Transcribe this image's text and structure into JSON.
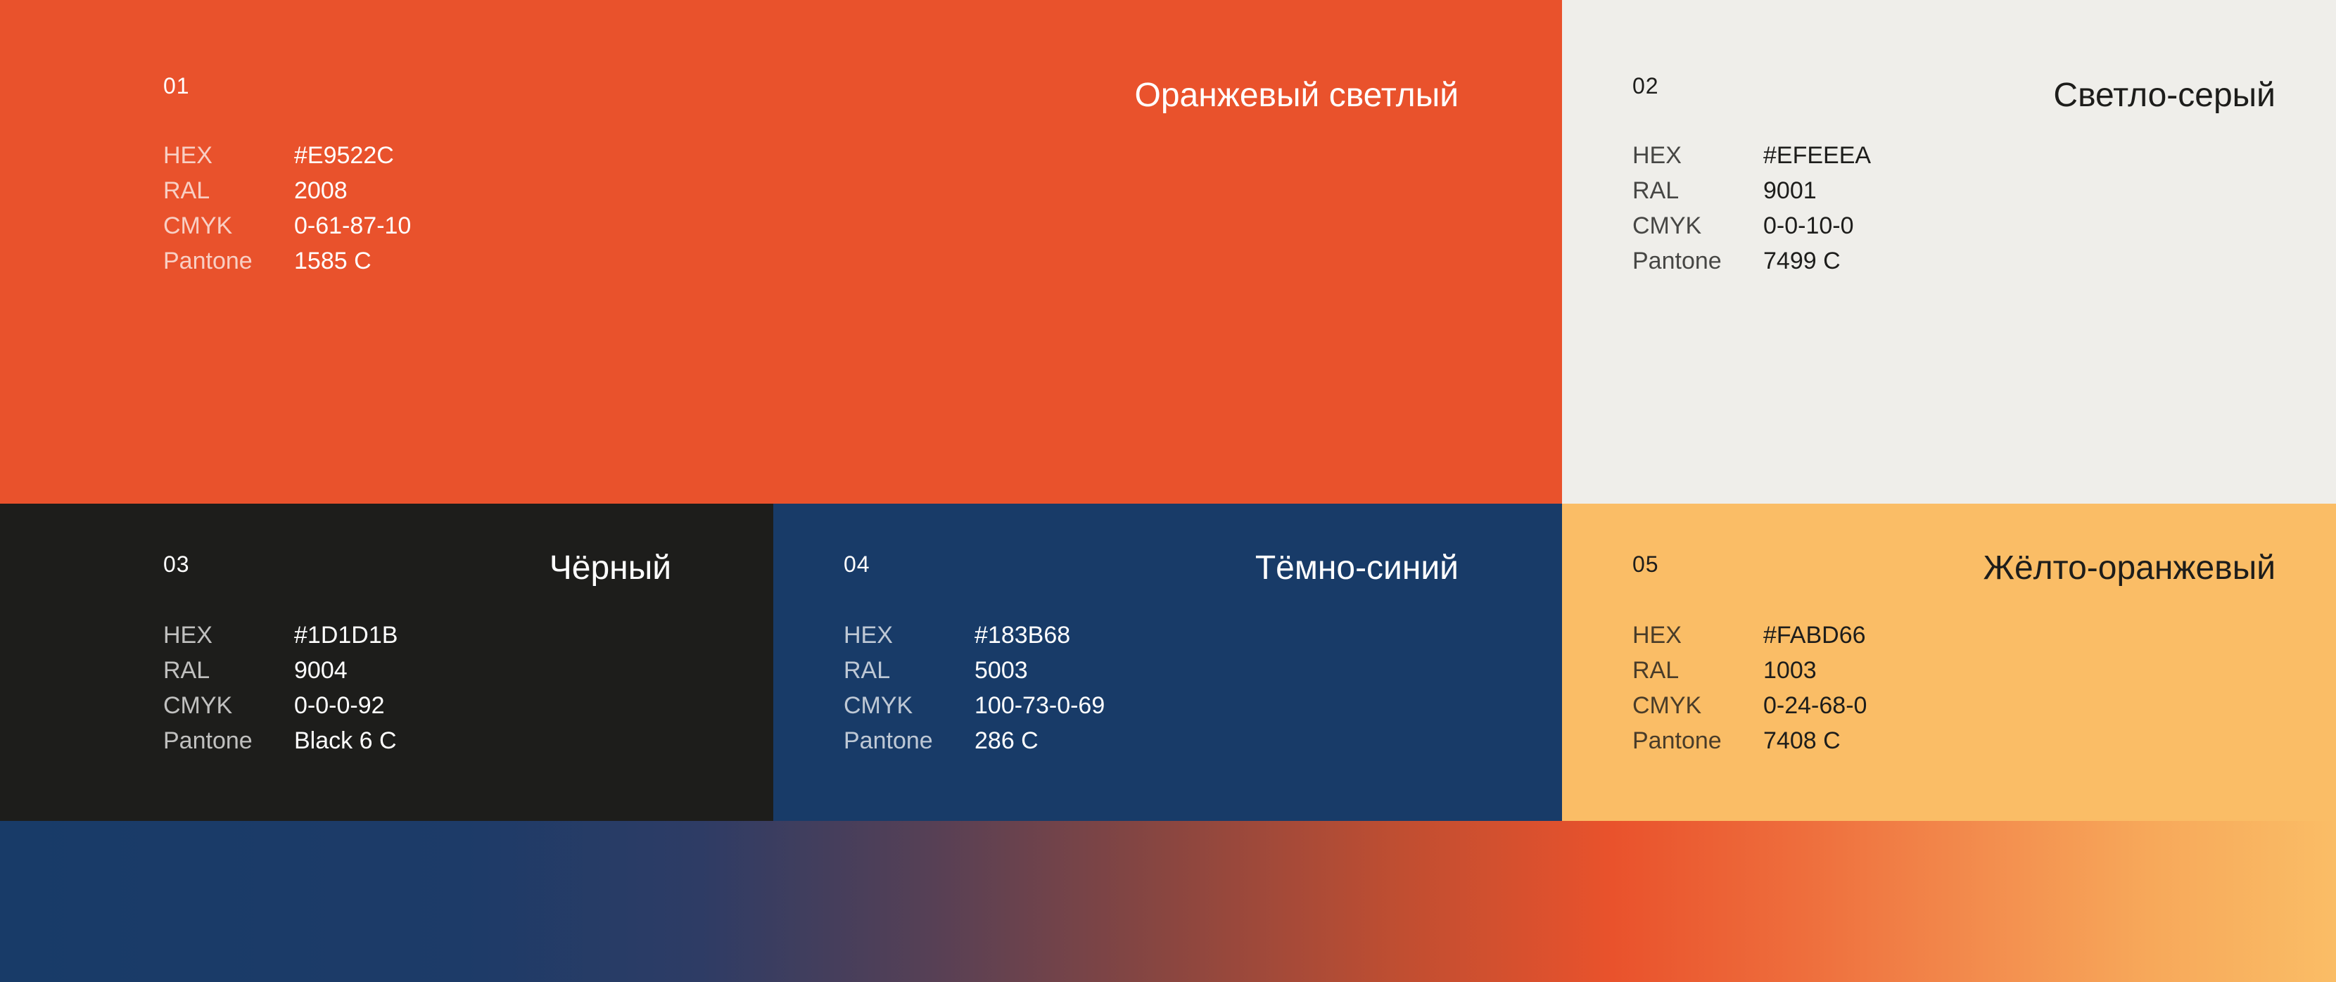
{
  "swatches": [
    {
      "number": "01",
      "name": "Оранжевый светлый",
      "color": "#E9522C",
      "labels": {
        "hex": "HEX",
        "ral": "RAL",
        "cmyk": "CMYK",
        "pantone": "Pantone"
      },
      "hex": "#E9522C",
      "ral": "2008",
      "cmyk": "0-61-87-10",
      "pantone": "1585 C"
    },
    {
      "number": "02",
      "name": "Светло-серый",
      "color": "#EFEEEA",
      "labels": {
        "hex": "HEX",
        "ral": "RAL",
        "cmyk": "CMYK",
        "pantone": "Pantone"
      },
      "hex": "#EFEEEA",
      "ral": "9001",
      "cmyk": "0-0-10-0",
      "pantone": "7499 C"
    },
    {
      "number": "03",
      "name": "Чёрный",
      "color": "#1D1D1B",
      "labels": {
        "hex": "HEX",
        "ral": "RAL",
        "cmyk": "CMYK",
        "pantone": "Pantone"
      },
      "hex": "#1D1D1B",
      "ral": "9004",
      "cmyk": "0-0-0-92",
      "pantone": "Black 6 C"
    },
    {
      "number": "04",
      "name": "Тёмно-синий",
      "color": "#183B68",
      "labels": {
        "hex": "HEX",
        "ral": "RAL",
        "cmyk": "CMYK",
        "pantone": "Pantone"
      },
      "hex": "#183B68",
      "ral": "5003",
      "cmyk": "100-73-0-69",
      "pantone": "286 C"
    },
    {
      "number": "05",
      "name": "Жёлто-оранжевый",
      "color": "#FABD66",
      "labels": {
        "hex": "HEX",
        "ral": "RAL",
        "cmyk": "CMYK",
        "pantone": "Pantone"
      },
      "hex": "#FABD66",
      "ral": "1003",
      "cmyk": "0-24-68-0",
      "pantone": "7408 C"
    }
  ],
  "gradient": {
    "colors": [
      "#183B68",
      "#E9522C",
      "#FABD66"
    ]
  }
}
